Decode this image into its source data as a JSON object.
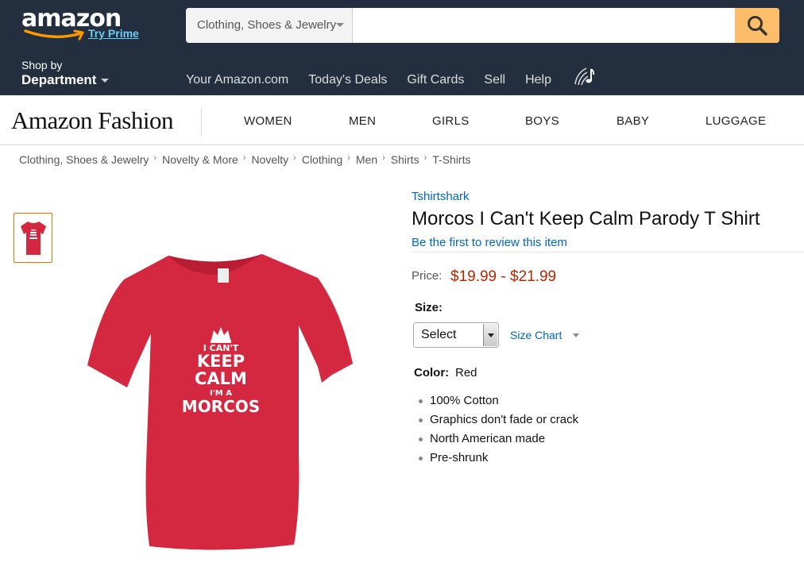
{
  "header": {
    "logo": "amazon",
    "try_prime": "Try Prime",
    "search_category": "Clothing, Shoes & Jewelry",
    "search_placeholder": "",
    "shop_by": "Shop by",
    "department": "Department",
    "nav_links": [
      "Your Amazon.com",
      "Today's Deals",
      "Gift Cards",
      "Sell",
      "Help"
    ],
    "colors": {
      "background": "#232f3e",
      "search_button": "#febd69"
    }
  },
  "fashion": {
    "logo": "Amazon Fashion",
    "nav": [
      "WOMEN",
      "MEN",
      "GIRLS",
      "BOYS",
      "BABY",
      "LUGGAGE"
    ]
  },
  "breadcrumb": [
    "Clothing, Shoes & Jewelry",
    "Novelty & More",
    "Novelty",
    "Clothing",
    "Men",
    "Shirts",
    "T-Shirts"
  ],
  "product": {
    "brand": "Tshirtshark",
    "title": "Morcos I Can't Keep Calm Parody T Shirt",
    "review_link": "Be the first to review this item",
    "price_label": "Price:",
    "price": "$19.99 - $21.99",
    "price_color": "#b12704",
    "size_label": "Size:",
    "size_select": "Select",
    "size_chart": "Size Chart",
    "color_label": "Color:",
    "color_value": "Red",
    "shirt_color": "#d42840",
    "shirt_text": {
      "line1": "I CAN'T",
      "line2": "KEEP",
      "line3": "CALM",
      "line4": "I'M A",
      "line5": "MORCOS"
    },
    "features": [
      "100% Cotton",
      "Graphics don't fade or crack",
      "North American made",
      "Pre-shrunk"
    ]
  }
}
